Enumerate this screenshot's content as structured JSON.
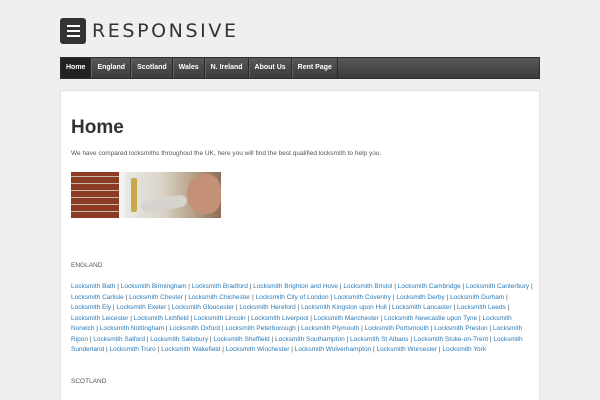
{
  "site": {
    "title": "RESPONSIVE"
  },
  "nav": {
    "items": [
      {
        "label": "Home",
        "active": true
      },
      {
        "label": "England"
      },
      {
        "label": "Scotland"
      },
      {
        "label": "Wales"
      },
      {
        "label": "N. Ireland"
      },
      {
        "label": "About Us"
      },
      {
        "label": "Rent Page"
      }
    ]
  },
  "main": {
    "title": "Home",
    "intro": "We have compared locksmiths throughout the UK, here you will find the best qualified locksmith to help you.",
    "sections": [
      {
        "heading": "ENGLAND",
        "links": [
          "Locksmith Bath",
          "Locksmith Birmingham",
          "Locksmith Bradford",
          "Locksmith Brighton and Hove",
          "Locksmith Bristol",
          "Locksmith Cambridge",
          "Locksmith Canterbury",
          "Locksmith Carlisle",
          "Locksmith Chester",
          "Locksmith Chichester",
          "Locksmith City of London",
          "Locksmith Coventry",
          "Locksmith Derby",
          "Locksmith Durham",
          "Locksmith Ely",
          "Locksmith Exeter",
          "Locksmith Gloucester",
          "Locksmith Hereford",
          "Locksmith Kingston upon Hull",
          "Locksmith Lancaster",
          "Locksmith Leeds",
          "Locksmith Leicester",
          "Locksmith Lichfield",
          "Locksmith Lincoln",
          "Locksmith Liverpool",
          "Locksmith Manchester",
          "Locksmith Newcastle upon Tyne",
          "Locksmith Norwich",
          "Locksmith Nottingham",
          "Locksmith Oxford",
          "Locksmith Peterborough",
          "Locksmith Plymouth",
          "Locksmith Portsmouth",
          "Locksmith Preston",
          "Locksmith Ripon",
          "Locksmith Salford",
          "Locksmith Salisbury",
          "Locksmith Sheffield",
          "Locksmith Southampton",
          "Locksmith St Albans",
          "Locksmith Stoke-on-Trent",
          "Locksmith Sunderland",
          "Locksmith Truro",
          "Locksmith Wakefield",
          "Locksmith Winchester",
          "Locksmith Wolverhampton",
          "Locksmith Worcester",
          "Locksmith York"
        ]
      },
      {
        "heading": "SCOTLAND",
        "links": []
      }
    ]
  },
  "colors": {
    "link": "#2a79b5",
    "nav_bg": "#474747",
    "nav_active": "#222222"
  }
}
